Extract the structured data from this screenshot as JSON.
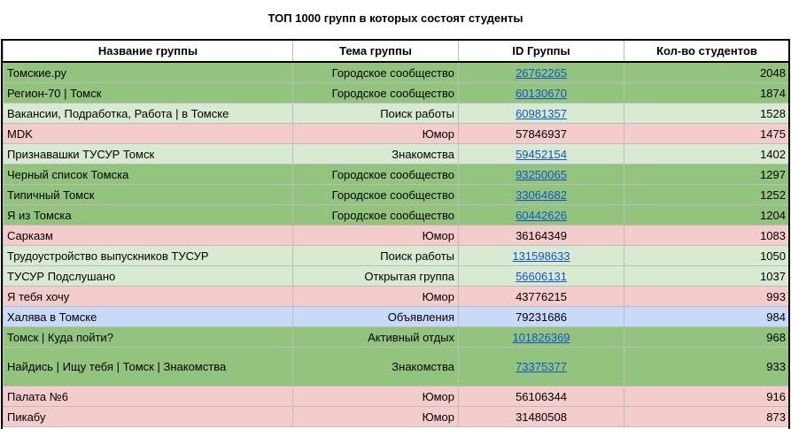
{
  "title": "ТОП 1000 групп в которых состоят студенты",
  "headers": {
    "name": "Название группы",
    "topic": "Тема группы",
    "id": "ID Группы",
    "count": "Кол-во студентов"
  },
  "colors": {
    "green": "#93c47d",
    "light_green": "#d9ead3",
    "red": "#f4cccc",
    "blue": "#c9daf8",
    "link": "#1155cc"
  },
  "rows": [
    {
      "name": "Томские.ру",
      "topic": "Городское сообщество",
      "id": "26762265",
      "count": "2048",
      "color": "green",
      "link": true
    },
    {
      "name": "Регион-70 | Томск",
      "topic": "Городское сообщество",
      "id": "60130670",
      "count": "1874",
      "color": "green",
      "link": true
    },
    {
      "name": "Вакансии, Подработка, Работа | в Томске",
      "topic": "Поиск работы",
      "id": "60981357",
      "count": "1528",
      "color": "light_green",
      "link": true
    },
    {
      "name": "MDK",
      "topic": "Юмор",
      "id": "57846937",
      "count": "1475",
      "color": "red",
      "link": false
    },
    {
      "name": "Признавашки ТУСУР Томск",
      "topic": "Знакомства",
      "id": "59452154",
      "count": "1402",
      "color": "light_green",
      "link": true
    },
    {
      "name": "Черный список Томска",
      "topic": "Городское сообщество",
      "id": "93250065",
      "count": "1297",
      "color": "green",
      "link": true
    },
    {
      "name": "Типичный Томск",
      "topic": "Городское сообщество",
      "id": "33064682",
      "count": "1252",
      "color": "green",
      "link": true
    },
    {
      "name": "Я из Томска",
      "topic": "Городское сообщество",
      "id": "60442626",
      "count": "1204",
      "color": "green",
      "link": true
    },
    {
      "name": "Сарказм",
      "topic": "Юмор",
      "id": "36164349",
      "count": "1083",
      "color": "red",
      "link": false
    },
    {
      "name": "Трудоустройство выпускников ТУСУР",
      "topic": "Поиск работы",
      "id": "131598633",
      "count": "1050",
      "color": "light_green",
      "link": true
    },
    {
      "name": "ТУСУР Подслушано",
      "topic": "Открытая группа",
      "id": "56606131",
      "count": "1037",
      "color": "light_green",
      "link": true
    },
    {
      "name": "Я тебя хочу",
      "topic": "Юмор",
      "id": "43776215",
      "count": "993",
      "color": "red",
      "link": false
    },
    {
      "name": "Халява в Томске",
      "topic": "Объявления",
      "id": "79231686",
      "count": "984",
      "color": "blue",
      "link": false
    },
    {
      "name": "Томск | Куда пойти?",
      "topic": "Активный отдых",
      "id": "101826369",
      "count": "968",
      "color": "green",
      "link": true
    },
    {
      "name": "Найдись | Ищу тебя | Томск | Знакомства",
      "topic": "Знакомства",
      "id": "73375377",
      "count": "933",
      "color": "green",
      "link": true,
      "tall": true
    },
    {
      "name": "Палата №6",
      "topic": "Юмор",
      "id": "56106344",
      "count": "916",
      "color": "red",
      "link": false
    },
    {
      "name": "Пикабу",
      "topic": "Юмор",
      "id": "31480508",
      "count": "873",
      "color": "red",
      "link": false
    }
  ]
}
